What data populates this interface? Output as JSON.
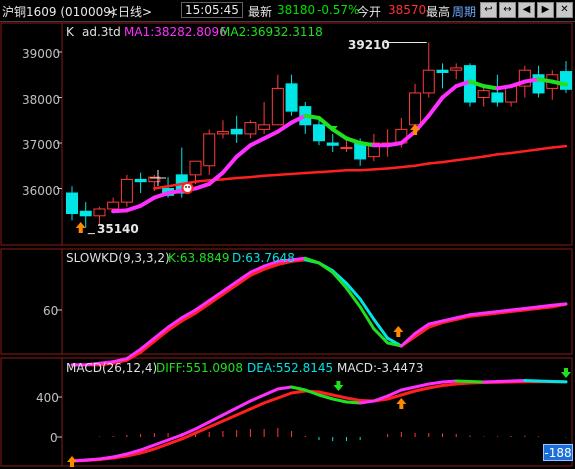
{
  "topbar": {
    "symbol": "沪铜1609 (010009)",
    "period": "<日线>",
    "time": "15:05:45",
    "latest_label": "最新",
    "latest_value": "38180",
    "change_pct": "-0.57%",
    "open_label": "今开",
    "open_value": "38570",
    "high_label": "最高",
    "period_link": "周期",
    "nav_buttons": [
      "↩",
      "↔",
      "◀",
      "▶",
      "✕"
    ]
  },
  "kline": {
    "legend_label": "K",
    "legend_title": "ad.3td",
    "ma1": "MA1:38282.8096",
    "ma2": "MA2:36932.3118",
    "y_ticks": [
      "39000",
      "38000",
      "37000",
      "36000"
    ],
    "high_marker": "39210",
    "low_marker": "35140"
  },
  "kd": {
    "legend": "SLOWKD(9,3,3,2)",
    "k_value": "K:63.8849",
    "d_value": "D:63.7648",
    "y_ticks": [
      "60"
    ]
  },
  "macd": {
    "legend": "MACD(26,12,4)",
    "diff": "DIFF:551.0908",
    "dea": "DEA:552.8145",
    "macd_value": "MACD:-3.4473",
    "y_ticks": [
      "400",
      "0"
    ],
    "last_value": "-188"
  },
  "colors": {
    "up": "#ff3b3b",
    "down": "#00e5e5",
    "ma1_up": "#ff30ff",
    "ma1_down": "#20e020",
    "ma2": "#ff2020",
    "grid": "#8b1a1a",
    "axis_text": "#c0c0c0"
  },
  "chart_data": [
    {
      "type": "candlestick",
      "title": "ad.3td",
      "ylim": [
        35000,
        39500
      ],
      "candles": [
        {
          "o": 35900,
          "h": 36050,
          "c": 35450,
          "l": 35300
        },
        {
          "o": 35500,
          "h": 35700,
          "c": 35400,
          "l": 35140
        },
        {
          "o": 35400,
          "h": 35600,
          "c": 35550,
          "l": 35200
        },
        {
          "o": 35550,
          "h": 35800,
          "c": 35700,
          "l": 35500
        },
        {
          "o": 35700,
          "h": 36300,
          "c": 36200,
          "l": 35600
        },
        {
          "o": 36200,
          "h": 36350,
          "c": 36150,
          "l": 35900
        },
        {
          "o": 36150,
          "h": 36300,
          "c": 36250,
          "l": 35950
        },
        {
          "o": 36000,
          "h": 36250,
          "c": 35850,
          "l": 35800
        },
        {
          "o": 36300,
          "h": 36900,
          "c": 35900,
          "l": 35800
        },
        {
          "o": 36300,
          "h": 36600,
          "c": 36600,
          "l": 36100
        },
        {
          "o": 36500,
          "h": 37300,
          "c": 37200,
          "l": 36300
        },
        {
          "o": 37200,
          "h": 37500,
          "c": 37250,
          "l": 37100
        },
        {
          "o": 37300,
          "h": 37600,
          "c": 37200,
          "l": 37000
        },
        {
          "o": 37200,
          "h": 37500,
          "c": 37450,
          "l": 37100
        },
        {
          "o": 37300,
          "h": 37900,
          "c": 37400,
          "l": 37200
        },
        {
          "o": 37400,
          "h": 38500,
          "c": 38200,
          "l": 37400
        },
        {
          "o": 38300,
          "h": 38500,
          "c": 37700,
          "l": 37600
        },
        {
          "o": 37800,
          "h": 37900,
          "c": 37400,
          "l": 37200
        },
        {
          "o": 37400,
          "h": 37500,
          "c": 37050,
          "l": 36950
        },
        {
          "o": 37000,
          "h": 37200,
          "c": 36950,
          "l": 36800
        },
        {
          "o": 36900,
          "h": 37100,
          "c": 36900,
          "l": 36800
        },
        {
          "o": 37000,
          "h": 37100,
          "c": 36650,
          "l": 36500
        },
        {
          "o": 36700,
          "h": 37200,
          "c": 37000,
          "l": 36600
        },
        {
          "o": 37000,
          "h": 37300,
          "c": 37000,
          "l": 36700
        },
        {
          "o": 37000,
          "h": 37550,
          "c": 37300,
          "l": 36900
        },
        {
          "o": 37400,
          "h": 38300,
          "c": 38100,
          "l": 37300
        },
        {
          "o": 38100,
          "h": 39210,
          "c": 38600,
          "l": 38000
        },
        {
          "o": 38600,
          "h": 38750,
          "c": 38550,
          "l": 38200
        },
        {
          "o": 38600,
          "h": 38750,
          "c": 38650,
          "l": 38400
        },
        {
          "o": 38700,
          "h": 38750,
          "c": 37900,
          "l": 37800
        },
        {
          "o": 38000,
          "h": 38300,
          "c": 38150,
          "l": 37800
        },
        {
          "o": 38100,
          "h": 38500,
          "c": 37900,
          "l": 37800
        },
        {
          "o": 37900,
          "h": 38300,
          "c": 38250,
          "l": 37800
        },
        {
          "o": 38250,
          "h": 38700,
          "c": 38600,
          "l": 38000
        },
        {
          "o": 38500,
          "h": 38700,
          "c": 38100,
          "l": 38000
        },
        {
          "o": 38200,
          "h": 38600,
          "c": 38500,
          "l": 37950
        },
        {
          "o": 38570,
          "h": 38800,
          "c": 38180,
          "l": 38100
        }
      ],
      "ma1": [
        null,
        null,
        null,
        35500,
        35520,
        35620,
        35800,
        35900,
        35950,
        36000,
        36100,
        36350,
        36700,
        36950,
        37100,
        37250,
        37450,
        37600,
        37550,
        37300,
        37100,
        37000,
        36950,
        36950,
        37000,
        37250,
        37600,
        38000,
        38250,
        38350,
        38250,
        38200,
        38250,
        38350,
        38400,
        38350,
        38283
      ],
      "ma2": [
        null,
        null,
        null,
        null,
        null,
        null,
        36000,
        36050,
        36100,
        36150,
        36180,
        36200,
        36230,
        36250,
        36280,
        36300,
        36320,
        36340,
        36360,
        36380,
        36400,
        36400,
        36420,
        36440,
        36470,
        36500,
        36550,
        36580,
        36620,
        36660,
        36700,
        36750,
        36780,
        36820,
        36860,
        36900,
        36932
      ]
    },
    {
      "type": "line",
      "title": "SLOWKD(9,3,3,2)",
      "ylim": [
        20,
        100
      ],
      "series": [
        {
          "name": "K",
          "values": [
            25,
            25,
            26,
            27,
            29,
            35,
            42,
            49,
            55,
            60,
            66,
            72,
            78,
            84,
            88,
            91,
            92,
            93,
            90,
            84,
            74,
            62,
            48,
            39,
            37,
            45,
            51,
            53,
            55,
            57,
            58,
            59,
            60,
            61,
            62,
            63,
            63.88
          ]
        },
        {
          "name": "D",
          "values": [
            25,
            25,
            25,
            26,
            28,
            33,
            40,
            47,
            53,
            58,
            64,
            70,
            76,
            82,
            86,
            89,
            91,
            92,
            90,
            85,
            77,
            67,
            54,
            42,
            37,
            43,
            49,
            52,
            54,
            56,
            57,
            58,
            59,
            60,
            61,
            62,
            63.76
          ]
        }
      ]
    },
    {
      "type": "line",
      "title": "MACD(26,12,4)",
      "ylim": [
        -250,
        650
      ],
      "series": [
        {
          "name": "DIFF",
          "values": [
            -240,
            -230,
            -220,
            -200,
            -170,
            -130,
            -80,
            -30,
            20,
            80,
            150,
            220,
            290,
            360,
            420,
            480,
            500,
            470,
            420,
            380,
            350,
            340,
            360,
            410,
            470,
            500,
            530,
            550,
            560,
            555,
            550,
            555,
            560,
            565,
            560,
            555,
            551.09
          ]
        },
        {
          "name": "DEA",
          "values": [
            -240,
            -235,
            -225,
            -210,
            -190,
            -160,
            -120,
            -70,
            -20,
            40,
            100,
            160,
            220,
            280,
            340,
            390,
            440,
            460,
            450,
            420,
            390,
            365,
            360,
            380,
            420,
            460,
            490,
            515,
            530,
            540,
            545,
            548,
            550,
            552,
            553,
            553,
            552.81
          ]
        }
      ],
      "bars": [
        0,
        0,
        5,
        10,
        20,
        30,
        40,
        40,
        40,
        40,
        50,
        60,
        70,
        80,
        80,
        90,
        60,
        10,
        -30,
        -40,
        -40,
        -30,
        0,
        30,
        50,
        40,
        40,
        35,
        30,
        15,
        5,
        7,
        10,
        13,
        7,
        2,
        -3.45
      ]
    }
  ]
}
